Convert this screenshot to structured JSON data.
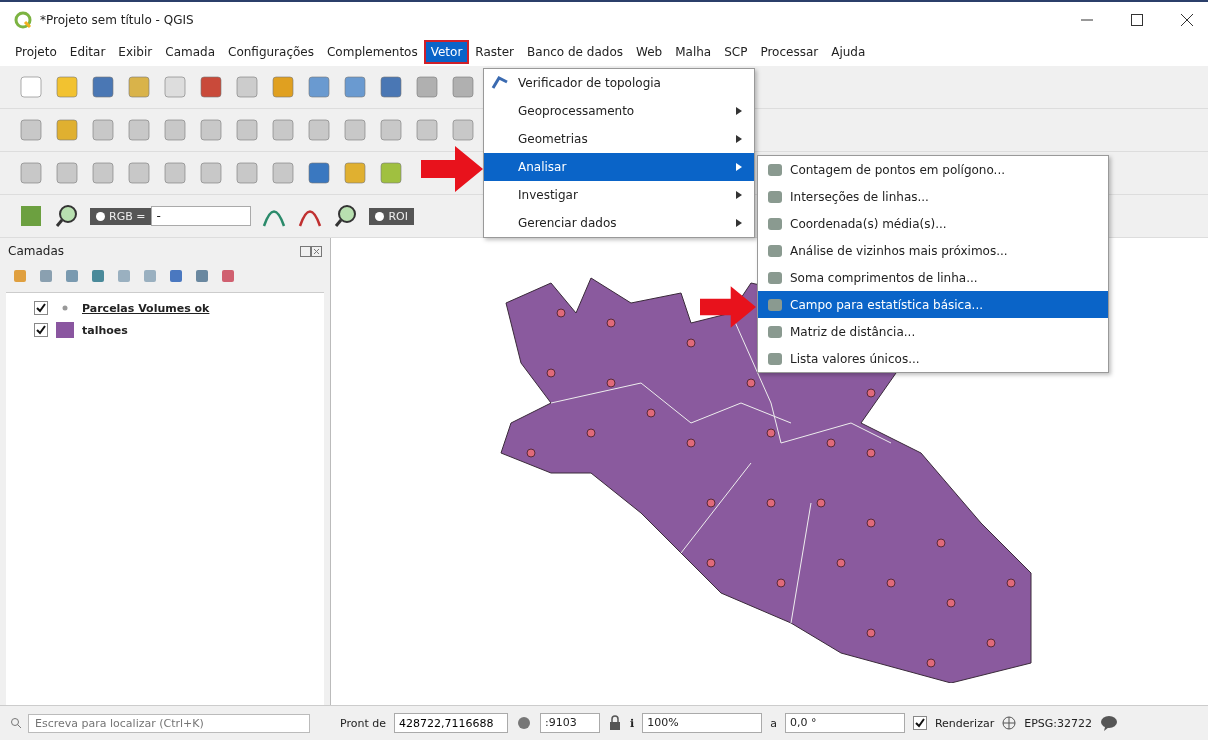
{
  "window": {
    "title": "*Projeto sem título - QGIS"
  },
  "menubar": [
    {
      "label": "Projeto",
      "selected": false
    },
    {
      "label": "Editar",
      "selected": false
    },
    {
      "label": "Exibir",
      "selected": false
    },
    {
      "label": "Camada",
      "selected": false
    },
    {
      "label": "Configurações",
      "selected": false
    },
    {
      "label": "Complementos",
      "selected": false
    },
    {
      "label": "Vetor",
      "selected": true
    },
    {
      "label": "Raster",
      "selected": false
    },
    {
      "label": "Banco de dados",
      "selected": false
    },
    {
      "label": "Web",
      "selected": false
    },
    {
      "label": "Malha",
      "selected": false
    },
    {
      "label": "SCP",
      "selected": false
    },
    {
      "label": "Processar",
      "selected": false
    },
    {
      "label": "Ajuda",
      "selected": false
    }
  ],
  "toolbar_combos": {
    "band_label": "RGB =",
    "band_value": "-",
    "roi_label": "ROI"
  },
  "vector_menu": [
    {
      "label": "Verificador de topologia",
      "submenu": false,
      "selected": false
    },
    {
      "label": "Geoprocessamento",
      "submenu": true,
      "selected": false
    },
    {
      "label": "Geometrias",
      "submenu": true,
      "selected": false
    },
    {
      "label": "Analisar",
      "submenu": true,
      "selected": true
    },
    {
      "label": "Investigar",
      "submenu": true,
      "selected": false
    },
    {
      "label": "Gerenciar dados",
      "submenu": true,
      "selected": false
    }
  ],
  "analysis_submenu": [
    {
      "label": "Contagem de pontos em polígono...",
      "selected": false
    },
    {
      "label": "Interseções de linhas...",
      "selected": false
    },
    {
      "label": "Coordenada(s) média(s)...",
      "selected": false
    },
    {
      "label": "Análise de vizinhos mais próximos...",
      "selected": false
    },
    {
      "label": "Soma comprimentos de linha...",
      "selected": false
    },
    {
      "label": "Campo para estatística básica...",
      "selected": true
    },
    {
      "label": "Matriz de distância...",
      "selected": false
    },
    {
      "label": "Lista valores únicos...",
      "selected": false
    }
  ],
  "layers_panel": {
    "title": "Camadas",
    "layers": [
      {
        "name": "Parcelas Volumes ok",
        "checked": true,
        "kind": "point"
      },
      {
        "name": "talhoes",
        "checked": true,
        "kind": "polygon"
      }
    ]
  },
  "status_bar": {
    "search_placeholder": "Escreva para localizar (Ctrl+K)",
    "coordinate_label": "Pront de",
    "coordinate": "428722,7116688",
    "scale": ":9103",
    "magnifier_label": "ℹ",
    "magnifier": "100%",
    "rotation_label": "a",
    "rotation": "0,0 °",
    "render_label": "Renderizar",
    "render_checked": true,
    "crs": "EPSG:32722"
  }
}
